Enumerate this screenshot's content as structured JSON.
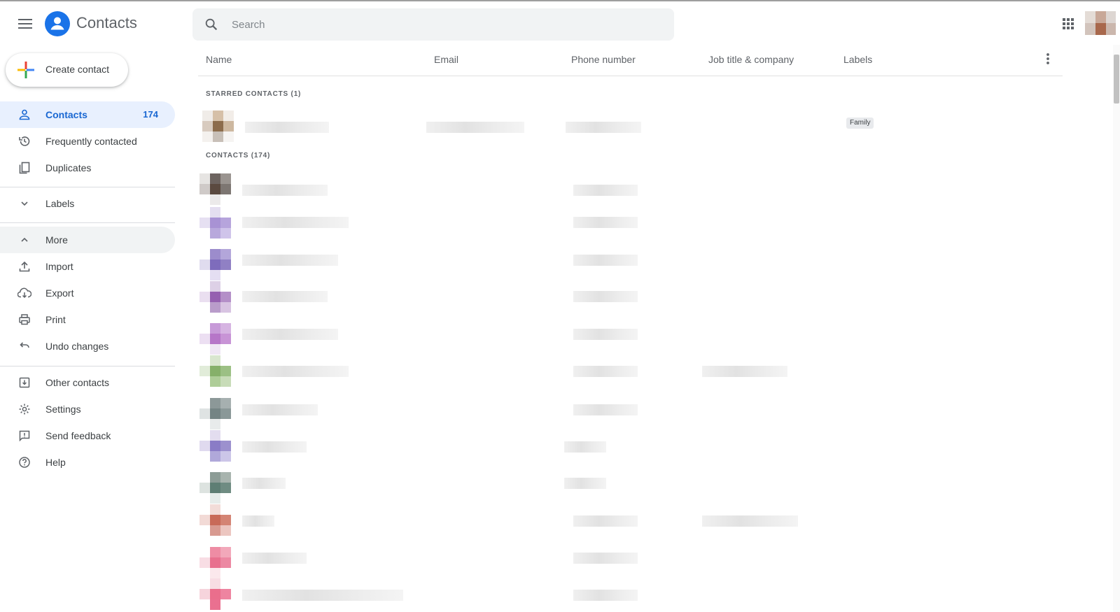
{
  "header": {
    "app_title": "Contacts",
    "search_placeholder": "Search"
  },
  "sidebar": {
    "create_label": "Create contact",
    "items": [
      {
        "label": "Contacts",
        "count": "174"
      },
      {
        "label": "Frequently contacted"
      },
      {
        "label": "Duplicates"
      },
      {
        "label": "Labels"
      },
      {
        "label": "More"
      },
      {
        "label": "Import"
      },
      {
        "label": "Export"
      },
      {
        "label": "Print"
      },
      {
        "label": "Undo changes"
      },
      {
        "label": "Other contacts"
      },
      {
        "label": "Settings"
      },
      {
        "label": "Send feedback"
      },
      {
        "label": "Help"
      }
    ]
  },
  "table": {
    "columns": [
      "Name",
      "Email",
      "Phone number",
      "Job title & company",
      "Labels"
    ],
    "starred_heading": "STARRED CONTACTS (1)",
    "contacts_heading": "CONTACTS (174)",
    "starred_row_label": "Family"
  },
  "colors": {
    "accent": "#1a73e8",
    "active_bg": "#e8f0fe",
    "active_text": "#1967d2"
  },
  "icons": {
    "menu": "menu-icon",
    "logo": "person-icon",
    "search": "search-icon",
    "apps": "apps-grid-icon",
    "create": "colored-plus-icon",
    "more_vert": "more-vert-icon"
  }
}
